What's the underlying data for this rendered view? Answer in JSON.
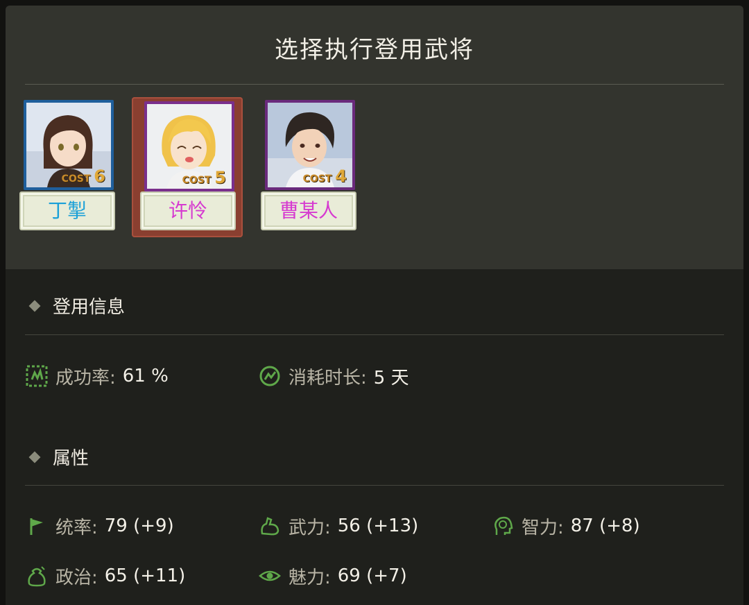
{
  "dialog": {
    "title": "选择执行登用武将"
  },
  "generals": [
    {
      "name": "丁掣",
      "cost_label": "COST",
      "cost": "6",
      "name_color": "#1aa0d8",
      "frame_color": "#1f5f9c",
      "selected": false
    },
    {
      "name": "许怜",
      "cost_label": "COST",
      "cost": "5",
      "name_color": "#d63ad0",
      "frame_color": "#7a2f8c",
      "selected": true
    },
    {
      "name": "曹某人",
      "cost_label": "COST",
      "cost": "4",
      "name_color": "#d63ad0",
      "frame_color": "#6a2a7c",
      "selected": false
    }
  ],
  "recruit_info": {
    "heading": "登用信息",
    "success_rate": {
      "label": "成功率:",
      "value": "61 %",
      "icon": "success-rate-icon"
    },
    "duration": {
      "label": "消耗时长:",
      "value": "5 天",
      "icon": "duration-icon"
    }
  },
  "attributes": {
    "heading": "属性",
    "leadership": {
      "label": "统率:",
      "value": "79 (+9)",
      "icon": "flag-icon"
    },
    "strength": {
      "label": "武力:",
      "value": "56 (+13)",
      "icon": "muscle-icon"
    },
    "intelligence": {
      "label": "智力:",
      "value": "87 (+8)",
      "icon": "brain-icon"
    },
    "politics": {
      "label": "政治:",
      "value": "65 (+11)",
      "icon": "money-bag-icon"
    },
    "charm": {
      "label": "魅力:",
      "value": "69 (+7)",
      "icon": "eye-icon"
    }
  },
  "colors": {
    "icon_green": "#5fa84a",
    "selected_bg": "#8a3f30"
  }
}
